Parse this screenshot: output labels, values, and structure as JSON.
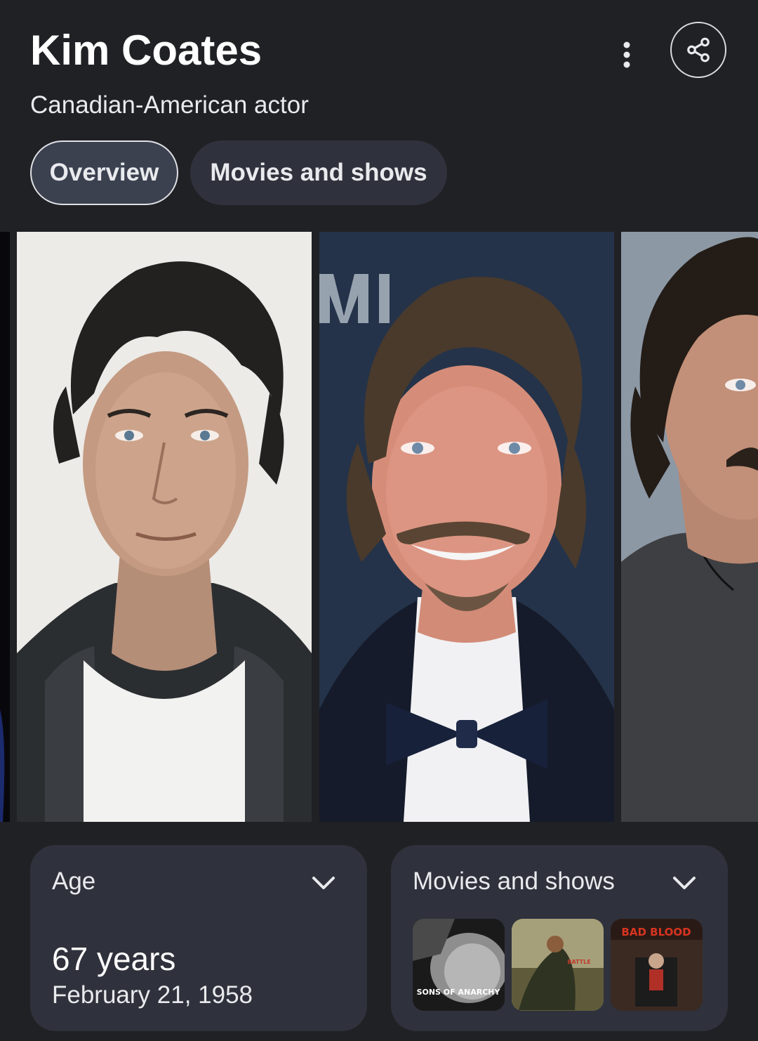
{
  "header": {
    "title": "Kim Coates",
    "subtitle": "Canadian-American actor"
  },
  "icons": {
    "more": "more-vert-icon",
    "share": "share-icon"
  },
  "tabs": [
    {
      "label": "Overview",
      "selected": true
    },
    {
      "label": "Movies and shows",
      "selected": false
    }
  ],
  "gallery": {
    "photos": [
      {
        "name": "portrait-leather-jacket"
      },
      {
        "name": "portrait-bow-tie"
      },
      {
        "name": "portrait-grey-shirt"
      }
    ]
  },
  "cards": {
    "age": {
      "title": "Age",
      "value": "67 years",
      "birthdate": "February 21, 1958"
    },
    "movies": {
      "title": "Movies and shows",
      "thumbs": [
        {
          "caption": "SONS OF ANARCHY"
        },
        {
          "caption": "BATTLE"
        },
        {
          "caption": "BAD BLOOD"
        }
      ]
    }
  },
  "colors": {
    "background": "#202124",
    "card": "#2f323c",
    "tab_selected": "#3c4150",
    "text": "#e8eaed"
  }
}
